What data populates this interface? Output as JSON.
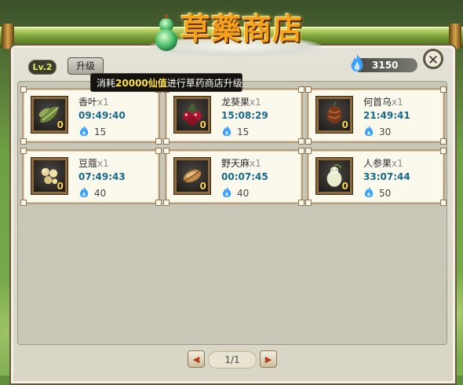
{
  "shop": {
    "title": "草藥商店",
    "level": "Lv.2",
    "upgrade_label": "升级",
    "tooltip": {
      "prefix": "消耗",
      "amount": "20000",
      "currency": "仙值",
      "suffix": "进行草药商店升级"
    },
    "spirit_value": "3150",
    "close_label": "✕"
  },
  "items": [
    {
      "name": "香叶",
      "qty": "x1",
      "time": "09:49:40",
      "price": "15",
      "count": "0",
      "icon": "leaf-icon"
    },
    {
      "name": "龙葵果",
      "qty": "x1",
      "time": "15:08:29",
      "price": "15",
      "count": "0",
      "icon": "berry-icon"
    },
    {
      "name": "何首乌",
      "qty": "x1",
      "time": "21:49:41",
      "price": "30",
      "count": "0",
      "icon": "root-icon"
    },
    {
      "name": "豆蔻",
      "qty": "x1",
      "time": "07:49:43",
      "price": "40",
      "count": "0",
      "icon": "seed-icon"
    },
    {
      "name": "野天麻",
      "qty": "x1",
      "time": "00:07:45",
      "price": "40",
      "count": "0",
      "icon": "tuber-icon"
    },
    {
      "name": "人参果",
      "qty": "x1",
      "time": "33:07:44",
      "price": "50",
      "count": "0",
      "icon": "ginseng-fruit-icon"
    }
  ],
  "pager": {
    "label": "1/1",
    "prev": "◀",
    "next": "▶"
  },
  "colors": {
    "accent": "#f3a21a",
    "timer": "#176a8a",
    "highlight": "#ffe23a"
  }
}
